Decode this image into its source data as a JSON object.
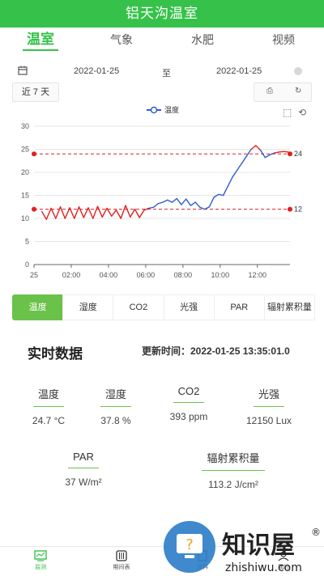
{
  "app": {
    "title": "铝天沟温室"
  },
  "tabs": [
    {
      "label": "温室",
      "active": true
    },
    {
      "label": "气象",
      "active": false
    },
    {
      "label": "水肥",
      "active": false
    },
    {
      "label": "视频",
      "active": false
    }
  ],
  "date_range": {
    "start": "2022-01-25",
    "separator": "至",
    "end": "2022-01-25"
  },
  "range_button": "近 7 天",
  "chart_data": {
    "type": "line",
    "legend": [
      "温度"
    ],
    "series": [
      {
        "name": "温度",
        "x": [
          "00:25",
          "00:40",
          "00:55",
          "01:10",
          "01:25",
          "01:40",
          "01:55",
          "02:10",
          "02:25",
          "02:40",
          "02:55",
          "03:10",
          "03:25",
          "03:40",
          "03:55",
          "04:10",
          "04:25",
          "04:40",
          "04:55",
          "05:10",
          "05:25",
          "05:40",
          "05:55",
          "06:10",
          "06:25",
          "06:40",
          "06:55",
          "07:10",
          "07:25",
          "07:40",
          "07:55",
          "08:10",
          "08:25",
          "08:40",
          "08:55",
          "09:10",
          "09:25",
          "09:40",
          "09:55",
          "10:10",
          "10:25",
          "10:40",
          "10:55",
          "11:10",
          "11:25",
          "11:40",
          "11:55",
          "12:10",
          "12:25",
          "12:40",
          "12:55",
          "13:10",
          "13:25",
          "13:40"
        ],
        "values": [
          11.5,
          9.8,
          12.2,
          10,
          12.5,
          10,
          12.3,
          10,
          12.5,
          10.2,
          12.3,
          10,
          12.6,
          10.3,
          12.2,
          10.5,
          11.8,
          10,
          12.8,
          10.3,
          12,
          10.2,
          11.8,
          12.2,
          12.4,
          13.2,
          13.5,
          14,
          13.5,
          14.3,
          13,
          14.2,
          12.8,
          13.5,
          12.4,
          12,
          12.5,
          14.6,
          15.2,
          15,
          17,
          19,
          20.5,
          22,
          23.5,
          25,
          25.8,
          24.8,
          23.2,
          23.8,
          24.2,
          24.4,
          24.5,
          24.4
        ]
      }
    ],
    "thresholds": [
      {
        "value": 24,
        "label": "24",
        "color": "#e02020"
      },
      {
        "value": 12,
        "label": "12",
        "color": "#e02020"
      }
    ],
    "below_threshold_color": "#e02020",
    "line_color": "#2d5fd0",
    "y_ticks": [
      0,
      5,
      10,
      15,
      20,
      25,
      30
    ],
    "ylim": [
      0,
      30
    ],
    "x_ticks": [
      "25",
      "02:00",
      "04:00",
      "06:00",
      "08:00",
      "10:00",
      "12:00"
    ],
    "x_tick_times": [
      "00:00",
      "02:00",
      "04:00",
      "06:00",
      "08:00",
      "10:00",
      "12:00"
    ],
    "xlim": [
      "00:00",
      "13:45"
    ],
    "grid": "horizontal"
  },
  "params": [
    {
      "label": "温度",
      "active": true
    },
    {
      "label": "湿度",
      "active": false
    },
    {
      "label": "CO2",
      "active": false
    },
    {
      "label": "光强",
      "active": false
    },
    {
      "label": "PAR",
      "active": false
    },
    {
      "label": "辐射累积量",
      "active": false
    }
  ],
  "realtime": {
    "title": "实时数据",
    "update_time": "更新时间：2022-01-25 13:35:01.0",
    "metrics": [
      {
        "label": "温度",
        "value": "24.7 °C"
      },
      {
        "label": "湿度",
        "value": "37.8 %"
      },
      {
        "label": "CO2",
        "value": "393 ppm"
      },
      {
        "label": "光强",
        "value": "12150 Lux"
      },
      {
        "label": "PAR",
        "value": "37 W/m²"
      },
      {
        "label": "辐射累积量",
        "value": "113.2 J/cm²"
      }
    ]
  },
  "bottom_nav": [
    {
      "label": "监测",
      "icon": "monitor-icon",
      "active": true
    },
    {
      "label": "期间表",
      "icon": "schedule-icon",
      "active": false
    },
    {
      "label": "资料",
      "icon": "files-icon",
      "active": false
    },
    {
      "label": "我的",
      "icon": "user-icon",
      "active": false
    }
  ],
  "watermark": {
    "text": "知识屋",
    "sub": "zhishiwu.com"
  }
}
